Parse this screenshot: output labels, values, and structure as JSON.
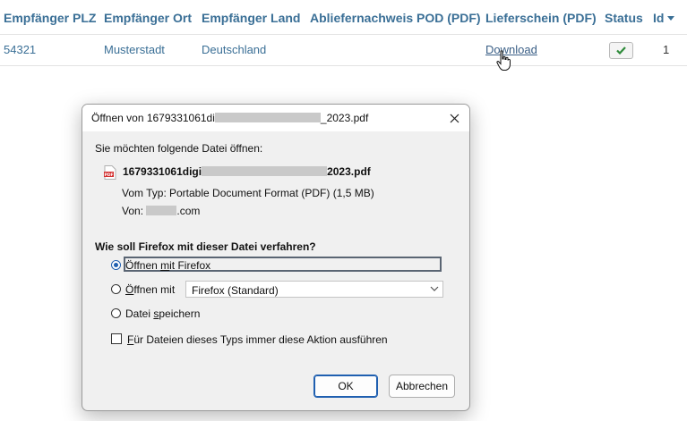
{
  "table": {
    "headers": [
      "Empfänger PLZ",
      "Empfänger Ort",
      "Empfänger Land",
      "Abliefernachweis POD (PDF)",
      "Lieferschein (PDF)",
      "Status",
      "Id"
    ],
    "row": {
      "plz": "54321",
      "ort": "Musterstadt",
      "land": "Deutschland",
      "pod": "",
      "lieferschein": "Download",
      "status": "check",
      "id": "1"
    }
  },
  "dialog": {
    "title_prefix": "Öffnen von 1679331061di",
    "title_suffix": "_2023.pdf",
    "intro": "Sie möchten folgende Datei öffnen:",
    "file_prefix": "1679331061digi",
    "file_suffix": "2023.pdf",
    "type_label": "Vom Typ:",
    "type_value": "Portable Document Format (PDF) (1,5 MB)",
    "from_label": "Von:",
    "from_suffix": ".com",
    "question": "Wie soll Firefox mit dieser Datei verfahren?",
    "options": {
      "open_with_firefox": "Öffnen mit Firefox",
      "open_with": "Öffnen mit",
      "save_file": "Datei speichern"
    },
    "open_with_select_value": "Firefox (Standard)",
    "selected_option": "open_with_firefox",
    "remember_label": "Für Dateien dieses Typs immer diese Aktion ausführen",
    "remember_checked": false,
    "ok_label": "OK",
    "cancel_label": "Abbrechen"
  },
  "icons": {
    "status": "checkmark-icon",
    "cursor": "hand-pointer-icon",
    "file": "pdf-file-icon",
    "close": "close-icon",
    "sort": "caret-down-icon",
    "select": "chevron-down-icon"
  },
  "colors": {
    "link": "#3a6f96",
    "status_check": "#2e8b3a",
    "accent": "#1f5fb0"
  }
}
